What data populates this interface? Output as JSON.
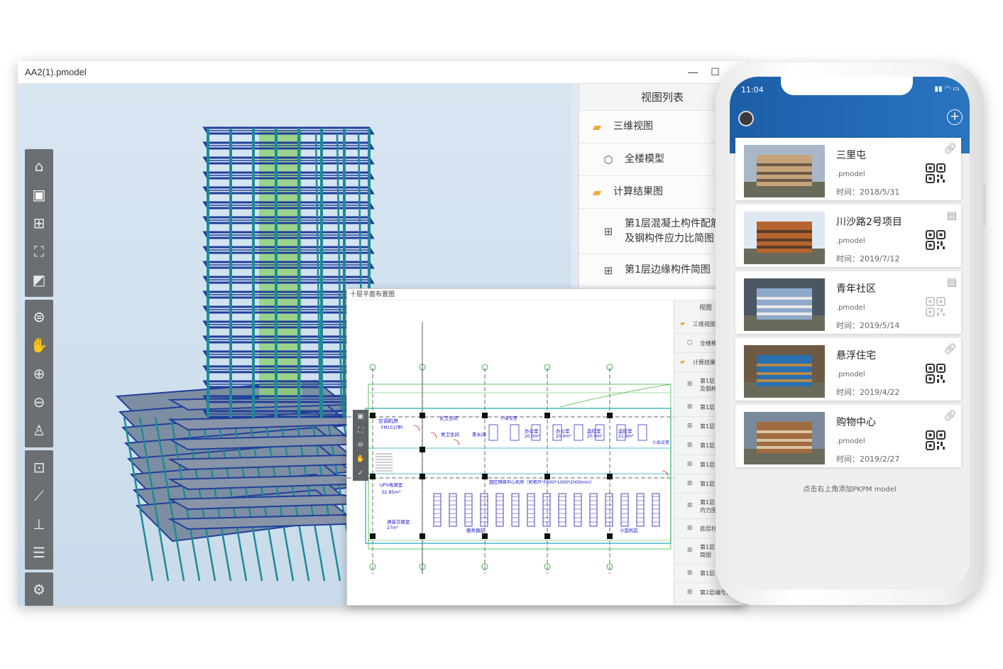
{
  "window": {
    "title": "AA2(1).pmodel",
    "minimize": "—",
    "maximize": "☐",
    "close": "×"
  },
  "toolbar": {
    "group1": [
      "home-icon",
      "view-icon",
      "grid-icon",
      "fit-icon",
      "cube-icon"
    ],
    "group2": [
      "orbit-icon",
      "pan-icon",
      "zoom-in-icon",
      "zoom-out-icon",
      "walk-icon"
    ],
    "group3": [
      "section-icon",
      "measure-icon",
      "tree-icon",
      "list-icon"
    ],
    "group4": [
      "settings-icon"
    ]
  },
  "view_panel": {
    "title": "视图列表",
    "items": [
      {
        "label": "三维视图",
        "icon": "folder-icon",
        "level": 0
      },
      {
        "label": "全楼模型",
        "icon": "cube-outline-icon",
        "level": 1
      },
      {
        "label": "计算结果图",
        "icon": "folder-icon",
        "level": 0
      },
      {
        "label": "第1层混凝土构件配筋\n及钢构件应力比简图",
        "icon": "plan-icon",
        "level": 1
      },
      {
        "label": "第1层边缘构件简图",
        "icon": "plan-icon",
        "level": 1
      }
    ]
  },
  "plan": {
    "title": "十层平面布置图",
    "labels": {
      "room1": "空调机房",
      "room1b": "FM151(甲)",
      "room2": "女卫生间",
      "room3": "男卫生间",
      "room4": "茶水间",
      "room5": "小会议室",
      "room6": "办公室",
      "room6b": "20.0m²",
      "room7": "办公室",
      "room7b": "20.0m²",
      "room8": "监控室",
      "room8b": "20.0m²",
      "room9": "监控室",
      "room9b": "21.9m²",
      "room10": "小会议室",
      "room11": "UPS电源室",
      "room11b": "32.85m²",
      "room12": "园区网络中心机房（机柜尺寸600*1000*2000mm）",
      "room13": "语音交换室",
      "room13b": "27m²",
      "room14": "服务器区",
      "room15": "小型机区"
    },
    "mini_panel": {
      "title": "视图",
      "items": [
        {
          "label": "三维视图",
          "level": 0,
          "icon": "folder-icon"
        },
        {
          "label": "全楼模",
          "level": 1,
          "icon": "cube-outline-icon"
        },
        {
          "label": "计算结果",
          "level": 0,
          "icon": "folder-icon"
        },
        {
          "label": "第1层\n及钢构",
          "level": 1,
          "icon": "plan-icon"
        },
        {
          "label": "第1层",
          "level": 1,
          "icon": "plan-icon"
        },
        {
          "label": "第1层",
          "level": 1,
          "icon": "plan-icon"
        },
        {
          "label": "第1层",
          "level": 1,
          "icon": "plan-icon"
        },
        {
          "label": "第1层",
          "level": 1,
          "icon": "plan-icon"
        },
        {
          "label": "第1层",
          "level": 1,
          "icon": "plan-icon"
        },
        {
          "label": "第1层\n内力图",
          "level": 1,
          "icon": "plan-icon"
        },
        {
          "label": "底层柱",
          "level": 1,
          "icon": "plan-icon"
        },
        {
          "label": "第1层\n简图",
          "level": 1,
          "icon": "plan-icon"
        },
        {
          "label": "第1层",
          "level": 1,
          "icon": "plan-icon"
        },
        {
          "label": "第2层编号简",
          "level": 1,
          "icon": "plan-icon"
        }
      ]
    }
  },
  "phone": {
    "time": "11:04",
    "status": "signal wifi battery",
    "projects": [
      {
        "name": "三里屯",
        "type": ".pmodel",
        "date": "时间：2018/5/31",
        "corner_icon": "link-icon",
        "qr_active": true,
        "palette": [
          "#c7a37c",
          "#6b5a49",
          "#a9b8c8"
        ]
      },
      {
        "name": "川沙路2号项目",
        "type": ".pmodel",
        "date": "时间：2019/7/12",
        "corner_icon": "document-icon",
        "qr_active": true,
        "palette": [
          "#b5652f",
          "#5a3c2a",
          "#dfe8f2"
        ]
      },
      {
        "name": "青年社区",
        "type": ".pmodel",
        "date": "时间：2019/5/14",
        "corner_icon": "document-icon",
        "qr_active": false,
        "palette": [
          "#8da9c9",
          "#e7e7e7",
          "#4b5864"
        ]
      },
      {
        "name": "悬浮住宅",
        "type": ".pmodel",
        "date": "时间：2019/4/22",
        "corner_icon": "link-icon",
        "qr_active": true,
        "palette": [
          "#2a6fb0",
          "#b58a4c",
          "#6e5a42"
        ]
      },
      {
        "name": "购物中心",
        "type": ".pmodel",
        "date": "时间：2019/2/27",
        "corner_icon": "link-icon",
        "qr_active": true,
        "palette": [
          "#a06b3f",
          "#d9c4a3",
          "#7a8a9a"
        ]
      }
    ],
    "hint": "点击右上角添加PKPM model"
  },
  "colors": {
    "accent": "#1f64ad",
    "steel": "#1f3f9a",
    "column": "#1e8a98",
    "core": "#8fd07a"
  }
}
